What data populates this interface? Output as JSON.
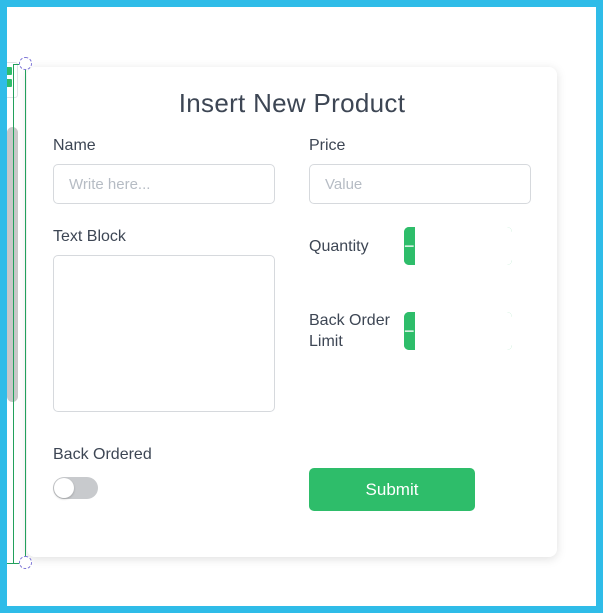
{
  "editor": {
    "frame_color": "#2fbce8",
    "selection_color": "#22a05c",
    "handle_border_color": "#7c74d6",
    "scrollbar_color": "#c8c8c8"
  },
  "theme": {
    "accent_green": "#2ebd6a",
    "text_color": "#3d4654",
    "border_color": "#d6d9dd",
    "placeholder_color": "#b6bcc4",
    "toggle_off_color": "#c8cacd"
  },
  "form": {
    "title": "Insert New Product",
    "name": {
      "label": "Name",
      "placeholder": "Write here...",
      "value": ""
    },
    "price": {
      "label": "Price",
      "placeholder": "Value",
      "value": ""
    },
    "text_block": {
      "label": "Text Block",
      "placeholder": "",
      "value": ""
    },
    "quantity": {
      "label": "Quantity",
      "value": "",
      "decrement_label": "−",
      "increment_label": "+"
    },
    "back_order_limit": {
      "label": "Back Order Limit",
      "value": "",
      "decrement_label": "−",
      "increment_label": "+"
    },
    "back_ordered": {
      "label": "Back Ordered",
      "state": "off"
    },
    "submit": {
      "label": "Submit"
    }
  }
}
